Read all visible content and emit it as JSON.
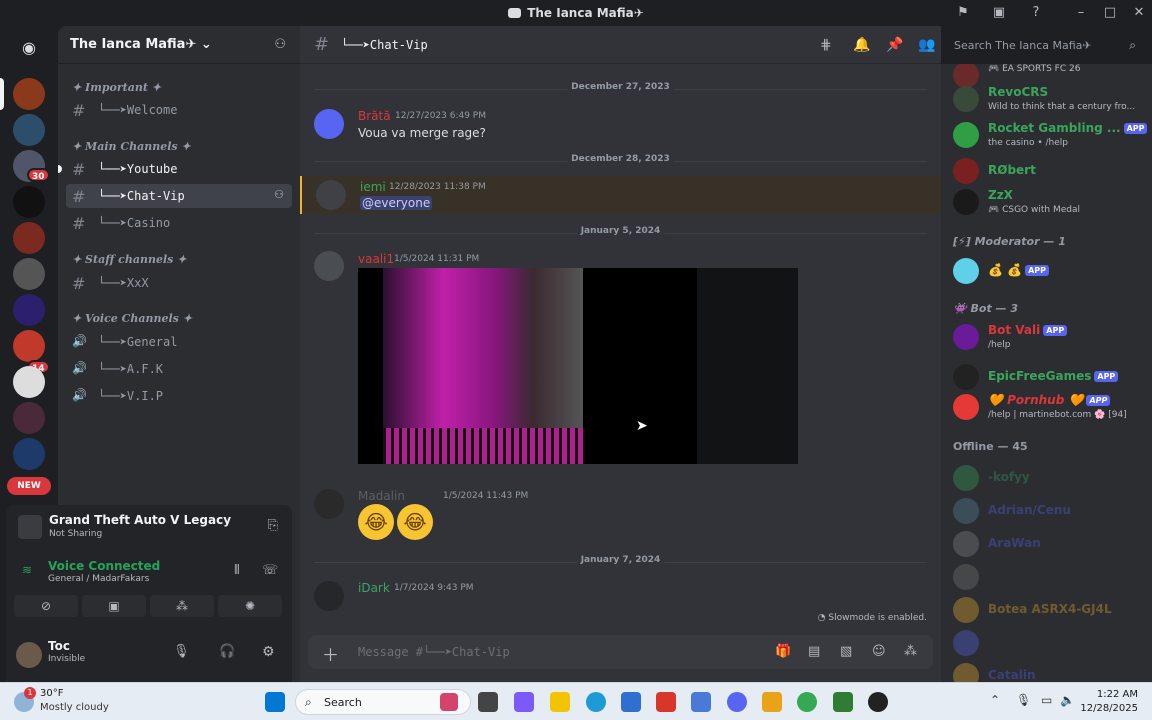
{
  "window": {
    "title": "The Ianca Mafia✈"
  },
  "server": {
    "name": "The Ianca Mafia✈",
    "dropdown_icon": "chevron-down-icon"
  },
  "rail": {
    "home_icon": "discord-logo-icon",
    "badges": [
      "30",
      "14"
    ],
    "new_label": "NEW"
  },
  "categories": [
    {
      "name": "✦ Important ✦",
      "channels": [
        {
          "name": "└──➤Welcome",
          "type": "text"
        }
      ]
    },
    {
      "name": "✦ Main Channels ✦",
      "channels": [
        {
          "name": "└──➤Youtube",
          "type": "text"
        },
        {
          "name": "└──➤Chat-Vip",
          "type": "text",
          "selected": true
        },
        {
          "name": "└──➤Casino",
          "type": "text"
        }
      ]
    },
    {
      "name": "✦ Staff channels ✦",
      "channels": [
        {
          "name": "└──➤XxX",
          "type": "text"
        }
      ]
    },
    {
      "name": "✦ Voice Channels ✦",
      "channels": [
        {
          "name": "└──➤General",
          "type": "voice"
        },
        {
          "name": "└──➤A.F.K",
          "type": "voice"
        },
        {
          "name": "└──➤V.I.P",
          "type": "voice"
        }
      ]
    }
  ],
  "activity": {
    "game": "Grand Theft Auto V Legacy",
    "status": "Not Sharing"
  },
  "voice": {
    "title": "Voice Connected",
    "location": "General / MadarFakars"
  },
  "user": {
    "name": "Toc",
    "status": "Invisible"
  },
  "channel": {
    "name": "└──➤Chat-Vip",
    "search_placeholder": "Search The Ianca Mafia✈"
  },
  "messages": [
    {
      "divider": "December 27, 2023",
      "author": "Brătă",
      "time": "12/27/2023 6:49 PM",
      "text": "Voua va merge rage?"
    },
    {
      "divider": "December 28, 2023",
      "author": "iemi",
      "time": "12/28/2023 11:38 PM",
      "text": "@everyone"
    },
    {
      "divider": "January 5, 2024",
      "author": "vaali1",
      "time": "1/5/2024 11:31 PM",
      "text": ""
    },
    {
      "author": "Madalin",
      "time": "1/5/2024 11:43 PM",
      "text": "🤣🤣"
    },
    {
      "divider": "January 7, 2024",
      "author": "iDark",
      "time": "1/7/2024 9:43 PM",
      "text": ""
    }
  ],
  "slowmode": "Slowmode is enabled.",
  "composer": {
    "placeholder": "Message #└──➤Chat-Vip"
  },
  "members": {
    "top": [
      {
        "name": "",
        "status": "EA SPORTS FC 26",
        "color": "#f2f3f5"
      },
      {
        "name": "RevoCRS",
        "status": "Wild to think that a century fro...",
        "color": "#3ba55c"
      },
      {
        "name": "Rocket Gambling ...",
        "status": "the casino • /help",
        "color": "#3ba55c",
        "app": "APP"
      },
      {
        "name": "RØbert",
        "status": "",
        "color": "#3ba55c"
      },
      {
        "name": "ZzX",
        "status": "CSGO with Medal",
        "color": "#3ba55c"
      }
    ],
    "moderator_header": "Moderator — 1",
    "moderator": {
      "name": "",
      "app": "APP"
    },
    "bot_header": "Bot — 3",
    "bots": [
      {
        "name": "Bot Vali",
        "status": "/help",
        "color": "#da373c",
        "app": "APP"
      },
      {
        "name": "EpicFreeGames",
        "status": "",
        "color": "#3ba55c",
        "app": "APP"
      },
      {
        "name": "Pornhub",
        "status": "/help | martinebot.com 🌸 [94]",
        "color": "#da373c",
        "app": "APP"
      }
    ],
    "offline_header": "Offline — 45",
    "offline": [
      {
        "name": "-kofyy"
      },
      {
        "name": "Adrian/Cenu"
      },
      {
        "name": "AraWan"
      },
      {
        "name": ""
      },
      {
        "name": "Botea ASRX4-GJ4L"
      },
      {
        "name": ""
      },
      {
        "name": "Catalin"
      }
    ]
  },
  "taskbar": {
    "temp": "30°F",
    "weather": "Mostly cloudy",
    "search": "Search",
    "time": "1:22 AM",
    "date": "12/28/2025",
    "weather_badge": "1"
  }
}
